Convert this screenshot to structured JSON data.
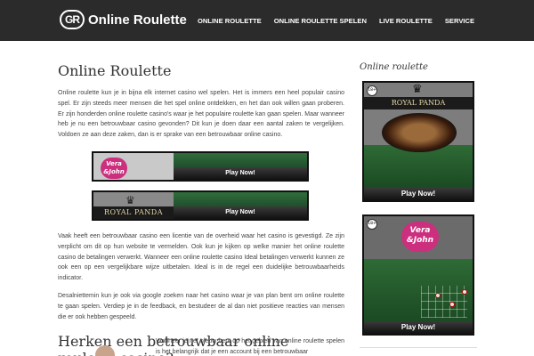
{
  "header": {
    "logo_mark": "GR",
    "logo_text": "Online Roulette",
    "nav": [
      {
        "label": "ONLINE ROULETTE"
      },
      {
        "label": "ONLINE ROULETTE SPELEN"
      },
      {
        "label": "LIVE ROULETTE"
      },
      {
        "label": "SERVICE"
      }
    ]
  },
  "main": {
    "title": "Online Roulette",
    "intro": "Online roulette kun je in bijna elk internet casino wel spelen. Het is immers een heel populair casino spel. Er zijn steeds meer mensen die het spel online ontdekken, en het dan ook willen gaan proberen. Er zijn honderden online roulette casino's waar je het populaire roulette kan gaan spelen. Maar wanneer heb je nu een betrouwbaar casino gevonden? Dit kun je doen daar een aantal zaken te vergelijken. Voldoen ze aan deze zaken, dan is er sprake van een betrouwbaar online casino.",
    "banners": [
      {
        "brand_line1": "Vera",
        "brand_line2": "&John",
        "button": "Play Now!"
      },
      {
        "brand": "ROYAL PANDA",
        "button": "Play Now!"
      }
    ],
    "para2": "Vaak heeft een betrouwbaar casino een licentie van de overheid waar het casino is gevestigd. Ze zijn verplicht om dit op hun website te vermelden. Ook kun je kijken op welke manier het online roulette casino de betalingen verwerkt. Wanneer een online roulette casino Ideal betalingen verwerkt kunnen ze ook een op een vergelijkbare wijze uitbetalen. Ideal is in de regel een duidelijke betrouwbaarheids indicator.",
    "para3": "Desalniettemin kun je ook via google zoeken naar het casino waar je van plan bent om online roulette te gaan spelen. Verdiep je in de feedback, en bestudeer de al dan niet positieve reacties van mensen die er ook hebben gespeeld.",
    "subtitle": "Herken een betrouwbaar online roulette casino?",
    "para4": "Wanneer je net nieuw bent op het gebied van online roulette spelen is het belangrijk dat je een account bij een betrouwbaar"
  },
  "sidebar": {
    "title": "Online roulette",
    "ads": [
      {
        "age": "18+",
        "brand": "ROYAL PANDA",
        "button": "Play Now!"
      },
      {
        "age": "18+",
        "brand_line1": "Vera",
        "brand_line2": "&John",
        "button": "Play Now!"
      }
    ]
  },
  "colors": {
    "header_bg": "#2b2b2b",
    "vera_pink": "#cc2f7d",
    "table_green": "#2e6b35"
  }
}
